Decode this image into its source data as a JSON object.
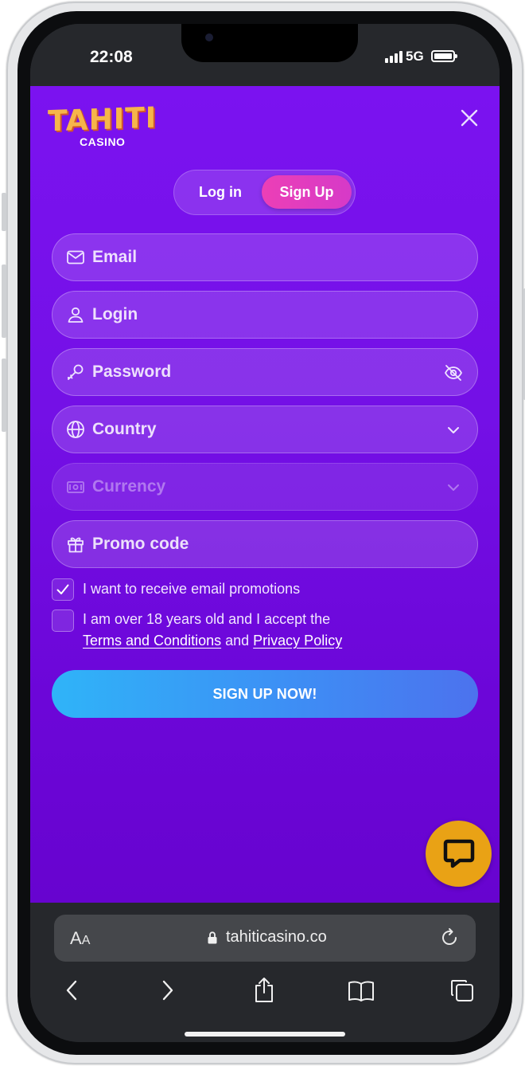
{
  "status_bar": {
    "time": "22:08",
    "network": "5G"
  },
  "logo": {
    "main": "TAHITI",
    "sub": "CASINO"
  },
  "auth_tabs": {
    "login": "Log in",
    "signup": "Sign Up",
    "active": "signup"
  },
  "fields": {
    "email": "Email",
    "login": "Login",
    "password": "Password",
    "country": "Country",
    "currency": "Currency",
    "promo": "Promo code"
  },
  "checkboxes": {
    "promotions": {
      "label": "I want to receive email promotions",
      "checked": true
    },
    "terms": {
      "text": "I am over 18 years old and I accept the",
      "terms_link": "Terms and Conditions",
      "and": "and",
      "privacy_link": "Privacy Policy",
      "checked": false
    }
  },
  "cta": {
    "label": "SIGN UP NOW!"
  },
  "browser": {
    "aa_big": "A",
    "aa_small": "A",
    "url": "tahiticasino.co"
  },
  "colors": {
    "background": "#7410e6",
    "accent_pink": "#ec3fb6",
    "cta_blue": "#3d8ff5",
    "chat_orange": "#e9a215",
    "logo_yellow": "#f6b54a"
  }
}
